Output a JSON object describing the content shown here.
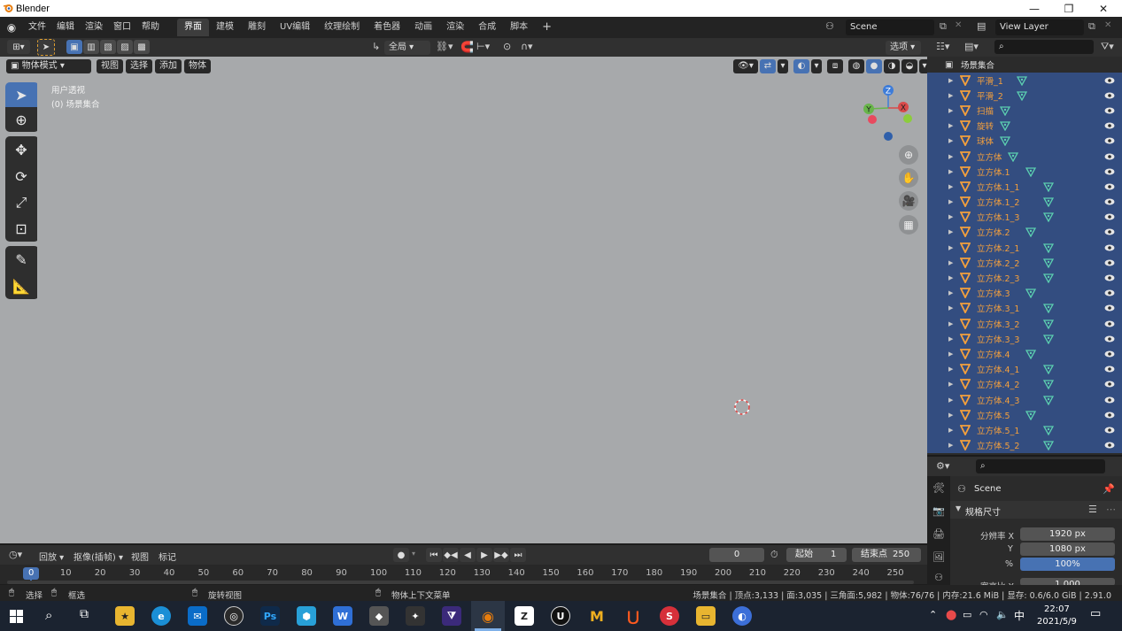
{
  "window": {
    "title": "Blender",
    "controls": [
      "—",
      "❐",
      "✕"
    ]
  },
  "topbar": {
    "menus": [
      "文件",
      "编辑",
      "渲染",
      "窗口",
      "帮助"
    ],
    "workspaces": [
      "界面",
      "建模",
      "雕刻",
      "UV编辑",
      "纹理绘制",
      "着色器",
      "动画",
      "渲染",
      "合成",
      "脚本"
    ],
    "active_workspace": "界面",
    "add_tab": "+",
    "scene": "Scene",
    "view_layer": "View Layer"
  },
  "view3d": {
    "transform_orientation": "全局",
    "options": "选项",
    "mode": "物体模式",
    "menus": [
      "视图",
      "选择",
      "添加",
      "物体"
    ],
    "overlay_title": "用户透视",
    "overlay_collection": "(0) 场景集合",
    "gizmo": {
      "z": "Z",
      "y": "Y",
      "x": "X"
    }
  },
  "outliner": {
    "root": "场景集合",
    "items": [
      "平滑_1",
      "平滑_2",
      "扫描",
      "旋转",
      "球体",
      "立方体",
      "立方体.1",
      "立方体.1_1",
      "立方体.1_2",
      "立方体.1_3",
      "立方体.2",
      "立方体.2_1",
      "立方体.2_2",
      "立方体.2_3",
      "立方体.3",
      "立方体.3_1",
      "立方体.3_2",
      "立方体.3_3",
      "立方体.4",
      "立方体.4_1",
      "立方体.4_2",
      "立方体.4_3",
      "立方体.5",
      "立方体.5_1",
      "立方体.5_2"
    ]
  },
  "properties": {
    "scene": "Scene",
    "panel": "规格尺寸",
    "res_x_label": "分辨率 X",
    "res_x": "1920 px",
    "res_y_label": "Y",
    "res_y": "1080 px",
    "pct_label": "%",
    "pct": "100%",
    "aspect_label": "宽高比 X",
    "aspect": "1.000"
  },
  "timeline": {
    "menus": [
      "回放",
      "抠像(插帧)",
      "视图",
      "标记"
    ],
    "current_frame": "0",
    "start_label": "起始",
    "start": "1",
    "end_label": "结束点",
    "end": "250",
    "ticks": [
      "0",
      "10",
      "20",
      "30",
      "40",
      "50",
      "60",
      "70",
      "80",
      "90",
      "100",
      "110",
      "120",
      "130",
      "140",
      "150",
      "160",
      "170",
      "180",
      "190",
      "200",
      "210",
      "220",
      "230",
      "240",
      "250"
    ]
  },
  "statusbar": {
    "select": "选择",
    "box": "框选",
    "rotate": "旋转视图",
    "context": "物体上下文菜单",
    "stats": "场景集合 | 顶点:3,133 | 面:3,035 | 三角面:5,982 | 物体:76/76 | 内存:21.6 MiB | 显存: 0.6/6.0 GiB | 2.91.0"
  },
  "taskbar": {
    "time": "22:07",
    "date": "2021/5/9",
    "ime": "中",
    "apps": [
      "Ps",
      "W",
      "M",
      "U"
    ]
  },
  "colors": {
    "accent": "#4772b3",
    "object_orange": "#f5a03c",
    "viewport": "#a7a9ab",
    "selected_row": "#334d80"
  }
}
